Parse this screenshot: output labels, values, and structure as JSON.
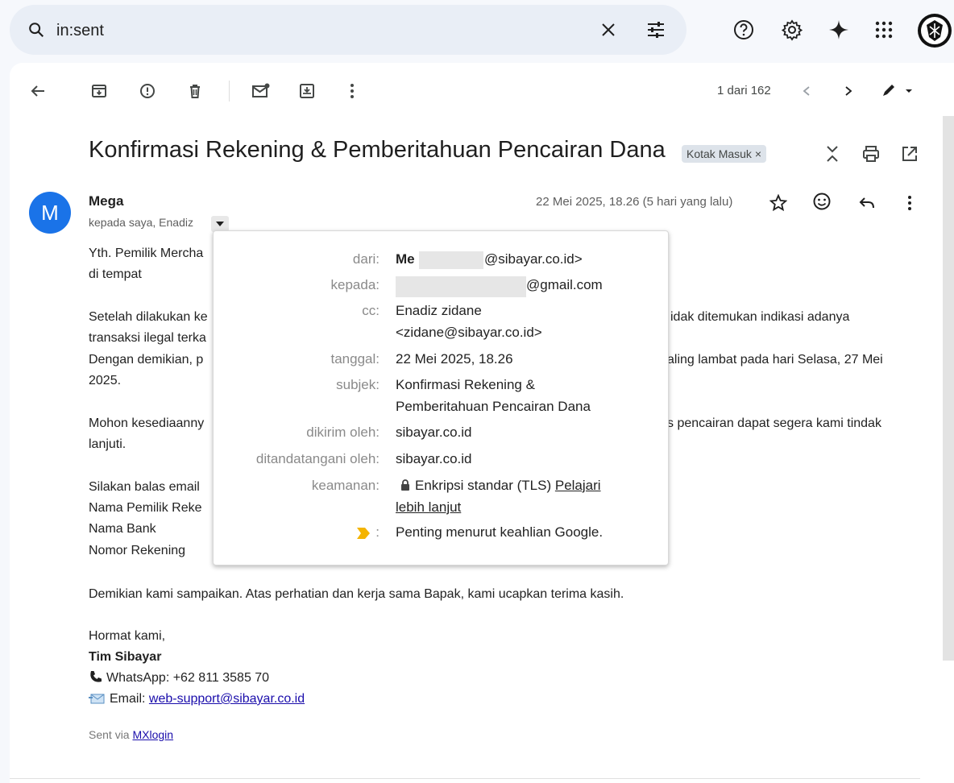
{
  "search": {
    "query": "in:sent"
  },
  "toolbar": {
    "counter": "1 dari 162"
  },
  "email": {
    "subject": "Konfirmasi Rekening & Pemberitahuan Pencairan Dana",
    "label": "Kotak Masuk ×",
    "avatar_letter": "M",
    "sender": "Mega",
    "recipients": "kepada saya, Enadiz",
    "date": "22 Mei 2025, 18.26 (5 hari yang lalu)",
    "body": {
      "greeting_1": "Yth. Pemilik Mercha",
      "greeting_2": "di tempat",
      "p1_l1_left": "Setelah dilakukan ke",
      "p1_l1_right": "idak ditemukan indikasi adanya",
      "p1_l2": "transaksi ilegal terka",
      "p1_l3_left": "Dengan demikian, p",
      "p1_l3_right": "aling lambat pada hari Selasa, 27 Mei",
      "p1_l4": "2025.",
      "p2_l1_left": "Mohon kesediaanny",
      "p2_l1_right": "s pencairan dapat segera kami tindak",
      "p2_l2": "lanjuti.",
      "p3_l1": "Silakan balas email",
      "p3_l2": "Nama Pemilik Reke",
      "p3_l3": "Nama Bank",
      "p3_l4": "Nomor Rekening",
      "closing": "Demikian kami sampaikan. Atas perhatian dan kerja sama Bapak, kami ucapkan terima kasih.",
      "regards": "Hormat kami,",
      "team": "Tim Sibayar",
      "whatsapp": "WhatsApp: +62 811 3585 70",
      "email_label": "Email: ",
      "email_link": "web-support@sibayar.co.id",
      "sent_via_label": "Sent via ",
      "sent_via_link": "MXlogin"
    }
  },
  "details": {
    "from_label": "dari:",
    "from_prefix": "Me",
    "from_suffix": "@sibayar.co.id>",
    "to_label": "kepada:",
    "to_suffix": "@gmail.com",
    "cc_label": "cc:",
    "cc_name": "Enadiz zidane",
    "cc_email": "<zidane@sibayar.co.id>",
    "date_label": "tanggal:",
    "date_value": "22 Mei 2025, 18.26",
    "subject_label": "subjek:",
    "subject_l1": "Konfirmasi Rekening &",
    "subject_l2": "Pemberitahuan Pencairan Dana",
    "mailed_by_label": "dikirim oleh:",
    "mailed_by": "sibayar.co.id",
    "signed_by_label": "ditandatangani oleh:",
    "signed_by": "sibayar.co.id",
    "security_label": "keamanan:",
    "security_value": "Enkripsi standar (TLS)",
    "security_link_1": "Pelajari",
    "security_link_2": "lebih lanjut",
    "importance_colon": ":",
    "importance_value": "Penting menurut keahlian Google."
  },
  "colors": {
    "accent": "#1a73e8",
    "importance": "#f4b400"
  }
}
